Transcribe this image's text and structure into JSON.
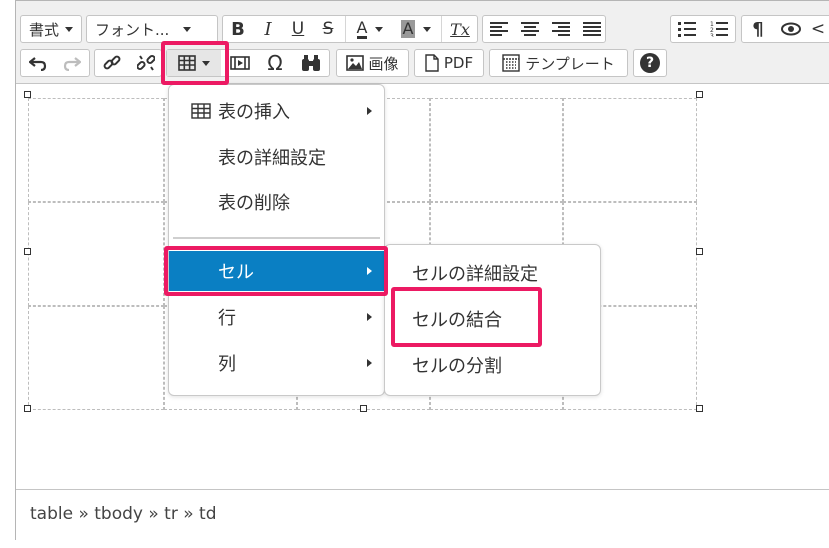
{
  "toolbar": {
    "row1": {
      "format_label": "書式",
      "font_label": "フォント...",
      "bold": "B",
      "italic": "I",
      "underline": "U",
      "strike": "S",
      "fore_color": "A",
      "back_color": "A",
      "clear_format": "Tx",
      "pilcrow": "¶",
      "more": "<"
    },
    "row2": {
      "omega": "Ω",
      "image_label": "画像",
      "pdf_label": "PDF",
      "template_label": "テンプレート",
      "help": "?"
    }
  },
  "table_menu": {
    "items": [
      {
        "label": "表の挿入"
      },
      {
        "label": "表の詳細設定"
      },
      {
        "label": "表の削除"
      },
      {
        "label": "セル"
      },
      {
        "label": "行"
      },
      {
        "label": "列"
      }
    ]
  },
  "cell_submenu": {
    "items": [
      {
        "label": "セルの詳細設定"
      },
      {
        "label": "セルの結合"
      },
      {
        "label": "セルの分割"
      }
    ]
  },
  "statusbar": {
    "path": "table » tbody » tr » td"
  },
  "colors": {
    "highlight": "#ec1a63",
    "active_menu": "#0a7fc3"
  }
}
